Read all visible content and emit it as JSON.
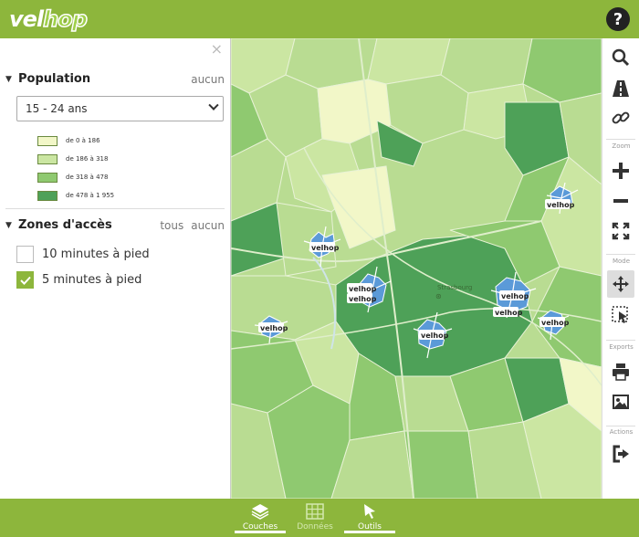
{
  "app": {
    "logo_text_1": "vel",
    "logo_text_2": "hop",
    "help_label": "?"
  },
  "sidebar": {
    "close_label": "×",
    "population": {
      "title": "Population",
      "none_link": "aucun",
      "select_value": "15 - 24 ans",
      "legend": [
        {
          "label": "de 0 à 186",
          "color": "#f2f7c8"
        },
        {
          "label": "de 186 à 318",
          "color": "#cbe6a2"
        },
        {
          "label": "de 318 à 478",
          "color": "#8fc970"
        },
        {
          "label": "de 478 à 1 955",
          "color": "#4ea158"
        }
      ]
    },
    "zones": {
      "title": "Zones d'accès",
      "all_link": "tous",
      "none_link": "aucun",
      "options": [
        {
          "label": "10 minutes à pied",
          "checked": false
        },
        {
          "label": "5 minutes à pied",
          "checked": true
        }
      ]
    }
  },
  "map": {
    "city_label": "Strasbourg",
    "station_label": "velhop",
    "accent_blue": "#5b9ad8"
  },
  "toolbar": {
    "tools": [
      {
        "name": "search-icon",
        "glyph": "search"
      },
      {
        "name": "route-icon",
        "glyph": "road"
      },
      {
        "name": "link-icon",
        "glyph": "link"
      }
    ],
    "zoom_label": "Zoom",
    "mode_label": "Mode",
    "exports_label": "Exports",
    "actions_label": "Actions"
  },
  "bottom": {
    "tabs": [
      {
        "label": "Couches",
        "active": true
      },
      {
        "label": "Données",
        "active": false
      },
      {
        "label": "Outils",
        "active": true
      }
    ]
  },
  "colors": {
    "brand": "#8db63c",
    "dark_green": "#4ea158"
  }
}
